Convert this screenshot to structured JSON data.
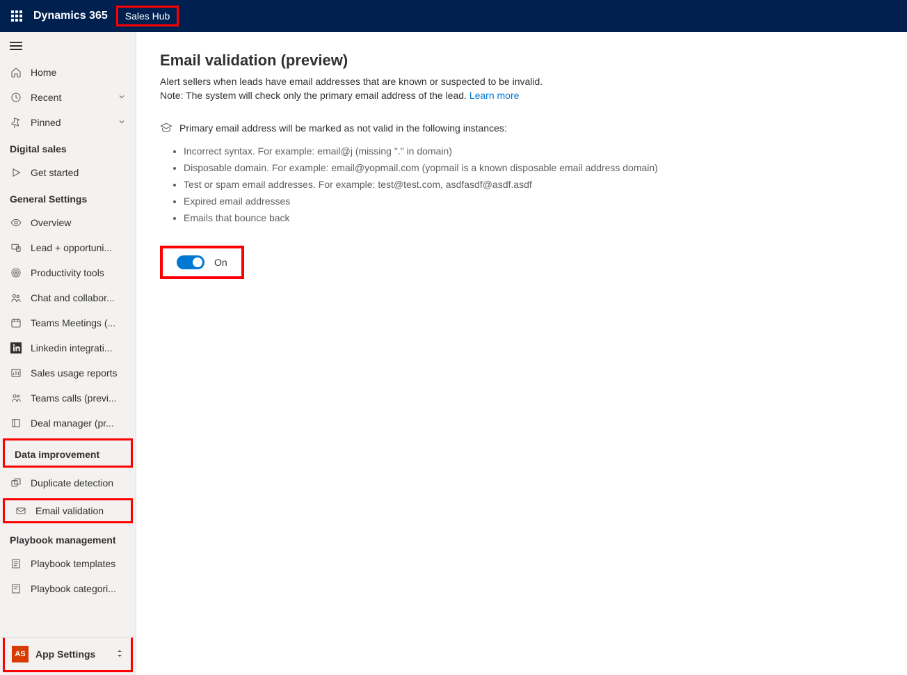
{
  "header": {
    "brand": "Dynamics 365",
    "app": "Sales Hub"
  },
  "sidebar": {
    "nav_top": [
      {
        "label": "Home",
        "icon": "home",
        "chev": false
      },
      {
        "label": "Recent",
        "icon": "clock",
        "chev": true
      },
      {
        "label": "Pinned",
        "icon": "pin",
        "chev": true
      }
    ],
    "section_digital": "Digital sales",
    "items_digital": [
      {
        "label": "Get started",
        "icon": "play"
      }
    ],
    "section_general": "General Settings",
    "items_general": [
      {
        "label": "Overview",
        "icon": "eye"
      },
      {
        "label": "Lead + opportuni...",
        "icon": "device"
      },
      {
        "label": "Productivity tools",
        "icon": "target"
      },
      {
        "label": "Chat and collabor...",
        "icon": "people"
      },
      {
        "label": "Teams Meetings (...",
        "icon": "calendar"
      },
      {
        "label": "Linkedin integrati...",
        "icon": "linkedin"
      },
      {
        "label": "Sales usage reports",
        "icon": "chart"
      },
      {
        "label": "Teams calls (previ...",
        "icon": "teams"
      },
      {
        "label": "Deal manager (pr...",
        "icon": "box"
      }
    ],
    "section_data": "Data improvement",
    "items_data": [
      {
        "label": "Duplicate detection",
        "icon": "dup"
      },
      {
        "label": "Email validation",
        "icon": "mail"
      }
    ],
    "section_playbook": "Playbook management",
    "items_playbook": [
      {
        "label": "Playbook templates",
        "icon": "template"
      },
      {
        "label": "Playbook categori...",
        "icon": "category"
      }
    ]
  },
  "area": {
    "badge": "AS",
    "label": "App Settings"
  },
  "main": {
    "title": "Email validation (preview)",
    "desc1": "Alert sellers when leads have email addresses that are known or suspected to be invalid.",
    "desc2_pre": "Note: The system will check only the primary email address of the lead. ",
    "learn": "Learn more",
    "info": "Primary email address will be marked as not valid in the following instances:",
    "cases": [
      "Incorrect syntax. For example: email@j (missing \".\" in domain)",
      "Disposable domain. For example: email@yopmail.com (yopmail is a known disposable email address domain)",
      "Test or spam email addresses. For example: test@test.com, asdfasdf@asdf.asdf",
      "Expired email addresses",
      "Emails that bounce back"
    ],
    "toggle_label": "On"
  }
}
